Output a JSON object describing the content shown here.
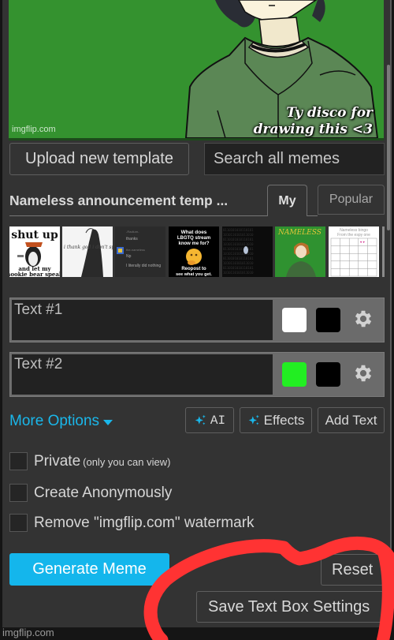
{
  "preview": {
    "caption_line1": "Ty disco for",
    "caption_line2": "drawing this <3",
    "watermark": "imgflip.com",
    "background_color": "#34922f"
  },
  "toolbar": {
    "upload_label": "Upload new template",
    "search_placeholder": "Search all memes"
  },
  "templates": {
    "current_title": "Nameless announcement temp ...",
    "tabs": [
      {
        "label": "My",
        "active": true
      },
      {
        "label": "Popular",
        "active": false
      }
    ],
    "thumbnails": [
      {
        "name": "shut-up-penguin",
        "top_text": "shut up",
        "bottom_text": "and let my nookie bear speak"
      },
      {
        "name": "sketch-figure",
        "text": "i thank god..."
      },
      {
        "name": "chat-screenshot",
        "lines": [
          "-Radium-",
          "thanks",
          "the-nameless",
          "Np",
          "I literally did nothing"
        ]
      },
      {
        "name": "lbgtq-stream",
        "top_text": "What does LBGTQ stream know me for?",
        "bottom_text": "Reopost to see what you get."
      },
      {
        "name": "dark-binary",
        "text": ""
      },
      {
        "name": "nameless-green",
        "text": "NAMELESS"
      },
      {
        "name": "nameless-bingo",
        "top_text": "Nameless bingo",
        "sub_text": "From the espy one"
      }
    ]
  },
  "text_boxes": [
    {
      "placeholder": "Text #1",
      "value": "",
      "text_color": "#ffffff",
      "outline_color": "#000000"
    },
    {
      "placeholder": "Text #2",
      "value": "",
      "text_color": "#22ee22",
      "outline_color": "#000000"
    }
  ],
  "options": {
    "more_options_label": "More Options",
    "ai_label": "AI",
    "effects_label": "Effects",
    "add_text_label": "Add Text",
    "accent_color": "#1ab7ea"
  },
  "checkboxes": [
    {
      "label": "Private",
      "sub_label": "(only you can view)",
      "checked": false
    },
    {
      "label": "Create Anonymously",
      "sub_label": "",
      "checked": false
    },
    {
      "label": "Remove \"imgflip.com\" watermark",
      "sub_label": "",
      "checked": false
    }
  ],
  "actions": {
    "generate_label": "Generate Meme",
    "reset_label": "Reset",
    "save_settings_label": "Save Text Box Settings"
  },
  "footer": {
    "watermark": "imgflip.com"
  },
  "annotation": {
    "color": "#ff3333",
    "description": "red hand-drawn circle around Save Text Box Settings"
  }
}
